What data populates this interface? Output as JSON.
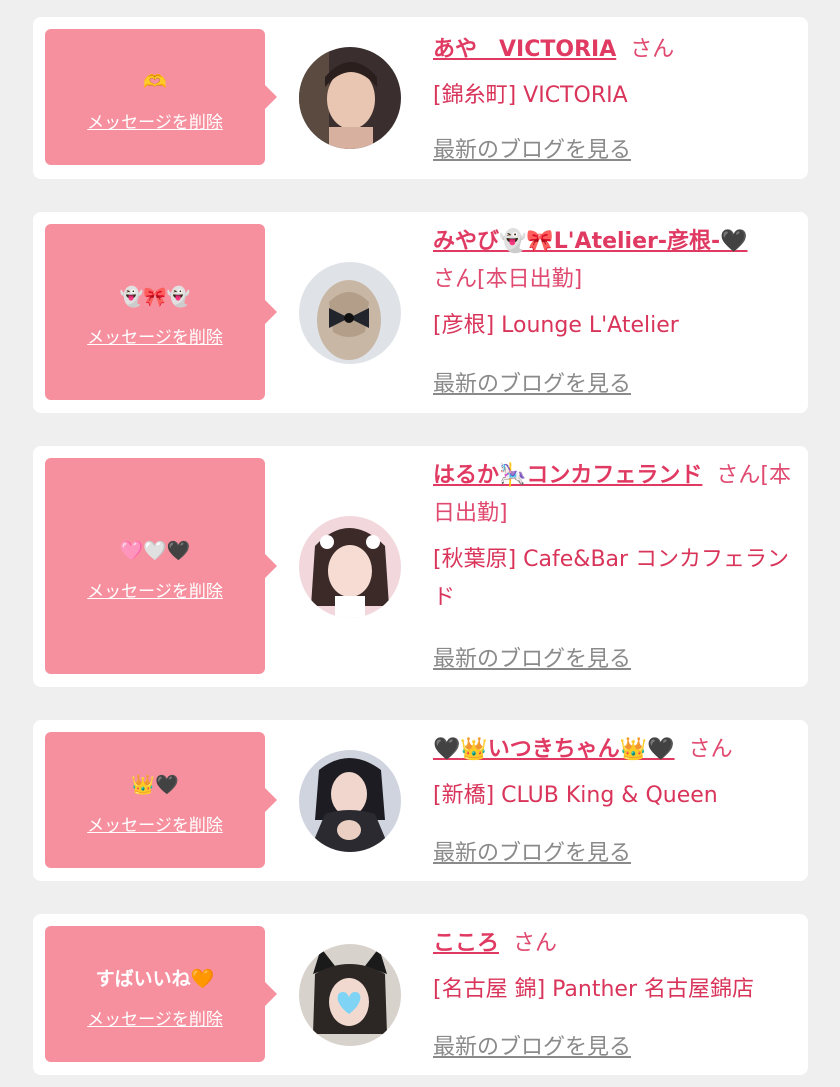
{
  "common": {
    "delete_label": "メッセージを削除",
    "blog_label": "最新のブログを見る",
    "san": "さん"
  },
  "cards": [
    {
      "message": "🫶",
      "name": "あや　VICTORIA",
      "name_suffix": "さん",
      "shop": "[錦糸町] VICTORIA"
    },
    {
      "message": "👻🎀👻",
      "name": "みやび👻🎀L'Atelier-彦根-🖤",
      "name_suffix": "さん[本日出勤]",
      "shop": "[彦根] Lounge L'Atelier"
    },
    {
      "message": "🩷🤍🖤",
      "name": "はるか🎠コンカフェランド",
      "name_suffix": "さん[本日出勤]",
      "shop": "[秋葉原] Cafe&Bar コンカフェランド"
    },
    {
      "message": "👑🖤",
      "name": "🖤👑いつきちゃん👑🖤",
      "name_suffix": "さん",
      "shop": "[新橋] CLUB King & Queen"
    },
    {
      "message": "すばいいね🧡",
      "name": "こころ",
      "name_suffix": "さん",
      "shop": "[名古屋 錦] Panther 名古屋錦店"
    }
  ],
  "colors": {
    "bubble": "#f7909e",
    "name": "#e03a62",
    "shop": "#d9345a",
    "blog": "#8a8a8a",
    "background": "#efefef"
  }
}
